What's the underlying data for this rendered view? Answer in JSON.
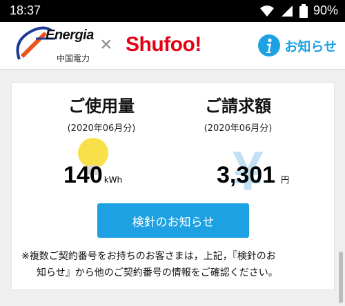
{
  "status_bar": {
    "time": "18:37",
    "battery": "90%"
  },
  "header": {
    "energia_brand": "Energia",
    "energia_sub": "中国電力",
    "separator": "×",
    "shufoo_brand": "Shufoo!",
    "notice_label": "お知らせ",
    "accent_color": "#1da1e2"
  },
  "usage": {
    "title": "ご使用量",
    "period": "(2020年06月分)",
    "value": "140",
    "unit": "kWh"
  },
  "billing": {
    "title": "ご請求額",
    "period": "(2020年06月分)",
    "value": "3,301",
    "unit": "円"
  },
  "button_label": "検針のお知らせ",
  "note_line1": "※複数ご契約番号をお持ちのお客さまは，上記，『検針のお",
  "note_line2": "知らせ』から他のご契約番号の情報をご確認ください。"
}
